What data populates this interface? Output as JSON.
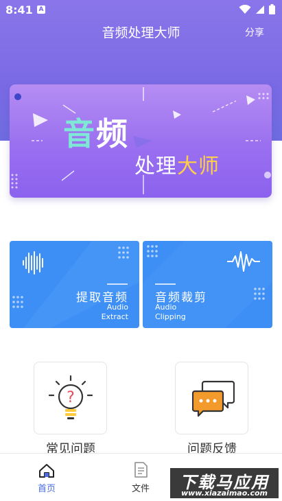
{
  "status_bar": {
    "time": "8:41",
    "notification_badge": "A"
  },
  "header": {
    "title": "音频处理大师",
    "share_label": "分享"
  },
  "banner": {
    "line1_accent": "音",
    "line1_rest": "频",
    "line2_rest": "处理",
    "line2_accent": "大师"
  },
  "cards": [
    {
      "title": "提取音频",
      "sub1": "Audio",
      "sub2": "Extract"
    },
    {
      "title": "音频裁剪",
      "sub1": "Audio",
      "sub2": "Clipping"
    }
  ],
  "quick_actions": [
    {
      "label": "常见问题",
      "icon": "lightbulb-question-icon"
    },
    {
      "label": "问题反馈",
      "icon": "chat-bubbles-icon"
    }
  ],
  "bottom_nav": [
    {
      "label": "首页",
      "icon": "home-icon",
      "active": true
    },
    {
      "label": "文件",
      "icon": "document-icon",
      "active": false
    }
  ],
  "watermark": {
    "main": "下载马应用",
    "url": "www.xiazaimao.com"
  },
  "colors": {
    "primary": "#7a6ae4",
    "card_blue": "#3d8ef5",
    "accent_teal": "#7ee7d6",
    "accent_yellow": "#ffcf4a",
    "nav_active": "#4a6de6"
  }
}
